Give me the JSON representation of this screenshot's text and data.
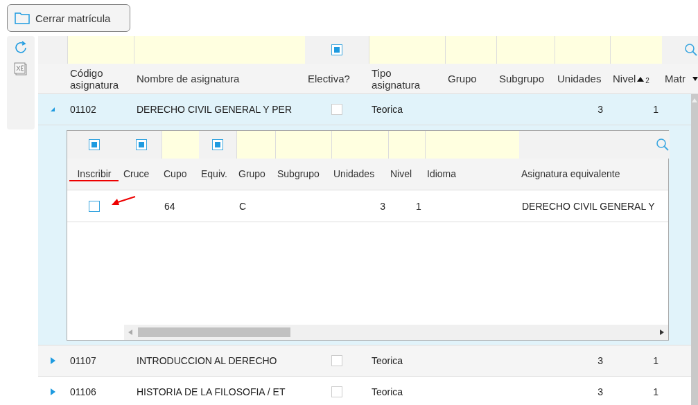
{
  "toolbar": {
    "close_button": "Cerrar matrícula"
  },
  "grid": {
    "filters": [
      {
        "kind": "none"
      },
      {
        "kind": "text"
      },
      {
        "kind": "text"
      },
      {
        "kind": "checkbox",
        "indeterminate": true
      },
      {
        "kind": "text"
      },
      {
        "kind": "text"
      },
      {
        "kind": "text"
      },
      {
        "kind": "text"
      },
      {
        "kind": "text"
      },
      {
        "kind": "search"
      }
    ],
    "columns": [
      {
        "label": "Código asignatura",
        "sorted": false
      },
      {
        "label": "Nombre de asignatura",
        "sorted": false
      },
      {
        "label": "Electiva?",
        "sorted": false
      },
      {
        "label": "Tipo asignatura",
        "sorted": false
      },
      {
        "label": "Grupo",
        "sorted": false
      },
      {
        "label": "Subgrupo",
        "sorted": false
      },
      {
        "label": "Unidades",
        "sorted": false
      },
      {
        "label": "Nivel",
        "sorted": true,
        "sort_index": "2"
      },
      {
        "label": "Matr",
        "sorted": false,
        "menu": true
      }
    ],
    "rows": [
      {
        "expanded": true,
        "selected": true,
        "code": "01102",
        "name": "DERECHO CIVIL GENERAL Y PER",
        "elective": false,
        "type": "Teorica",
        "units": "3",
        "level_text": "1",
        "detail": {
          "filters": [
            {
              "kind": "checkbox",
              "indeterminate": true
            },
            {
              "kind": "checkbox",
              "indeterminate": true
            },
            {
              "kind": "text"
            },
            {
              "kind": "checkbox",
              "indeterminate": true
            },
            {
              "kind": "text"
            },
            {
              "kind": "text"
            },
            {
              "kind": "text"
            },
            {
              "kind": "text"
            },
            {
              "kind": "text"
            },
            {
              "kind": "search"
            }
          ],
          "columns": [
            {
              "label": "Inscribir",
              "marked": true
            },
            {
              "label": "Cruce",
              "marked": false
            },
            {
              "label": "Cupo",
              "marked": false
            },
            {
              "label": "Equiv.",
              "marked": false
            },
            {
              "label": "Grupo",
              "marked": false
            },
            {
              "label": "Subgrupo",
              "marked": false
            },
            {
              "label": "Unidades",
              "marked": false
            },
            {
              "label": "Nivel",
              "marked": false
            },
            {
              "label": "Idioma",
              "marked": false
            },
            {
              "label": "Asignatura equivalente",
              "marked": false
            }
          ],
          "rows": [
            {
              "enroll": false,
              "pointed": true,
              "cupo": "64",
              "group": "C",
              "units": "3",
              "level_text": "1",
              "equivalent": "DERECHO CIVIL GENERAL Y"
            }
          ]
        }
      },
      {
        "expanded": false,
        "selected": false,
        "code": "01107",
        "name": "INTRODUCCION AL DERECHO",
        "elective": false,
        "type": "Teorica",
        "units": "3",
        "level_text": "1"
      },
      {
        "expanded": false,
        "selected": false,
        "code": "01106",
        "name": "HISTORIA DE LA FILOSOFIA / ET",
        "elective": false,
        "type": "Teorica",
        "units": "3",
        "level_text": "1"
      }
    ]
  }
}
